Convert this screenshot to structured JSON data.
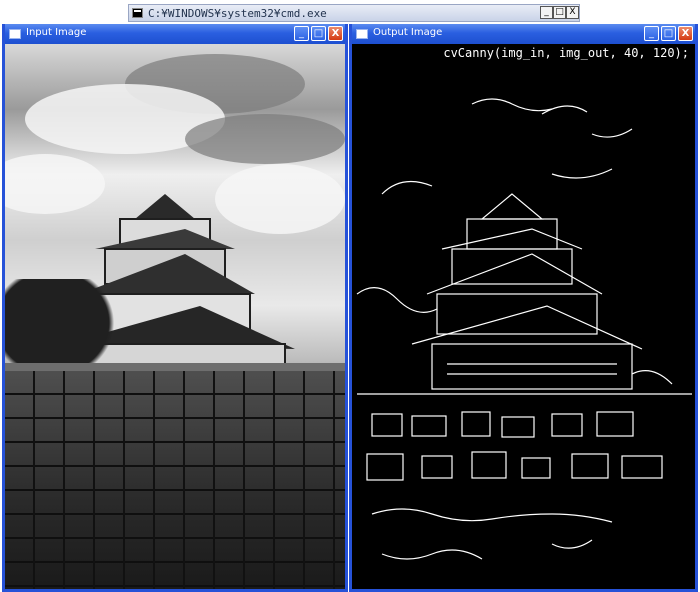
{
  "cmd_window": {
    "title": "C:¥WINDOWS¥system32¥cmd.exe",
    "buttons": {
      "minimize": "_",
      "maximize": "□",
      "close": "X"
    }
  },
  "input_window": {
    "title": "Input Image",
    "buttons": {
      "minimize": "_",
      "maximize": "□",
      "close": "X"
    }
  },
  "output_window": {
    "title": "Output Image",
    "caption": "cvCanny(img_in, img_out,  40, 120);",
    "buttons": {
      "minimize": "_",
      "maximize": "□",
      "close": "X"
    }
  },
  "colors": {
    "titlebar": "#2a5fe0",
    "close_button": "#d43a12",
    "edge_lines": "#ffffff",
    "edge_background": "#000000"
  }
}
